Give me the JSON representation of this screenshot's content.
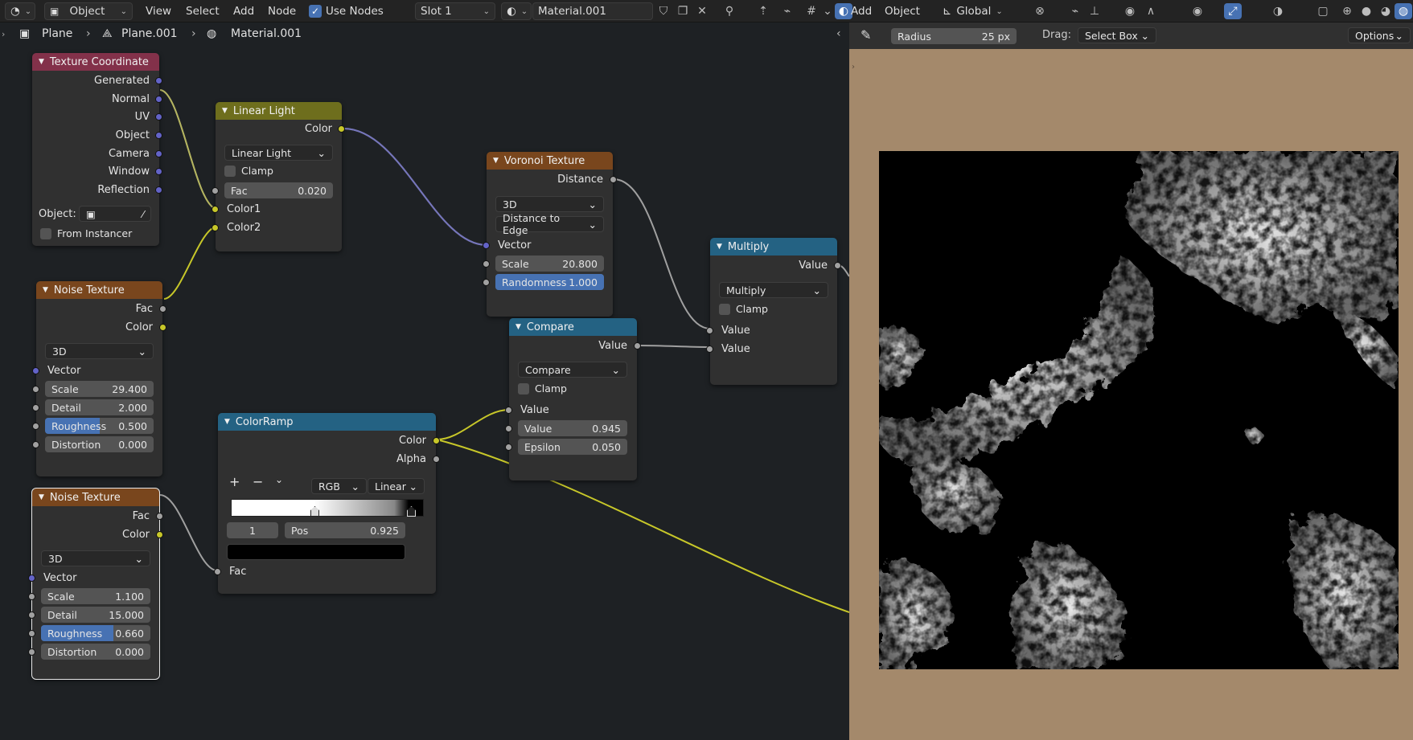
{
  "topbar": {
    "editor_type": "Object",
    "menus": [
      "View",
      "Select",
      "Add",
      "Node"
    ],
    "use_nodes_label": "Use Nodes",
    "slot": "Slot 1",
    "material": "Material.001",
    "right_menus": [
      "Add",
      "Object"
    ],
    "orientation": "Global"
  },
  "breadcrumb": {
    "object": "Plane",
    "mesh": "Plane.001",
    "material": "Material.001"
  },
  "nodes": {
    "texcoord": {
      "title": "Texture Coordinate",
      "outputs": [
        "Generated",
        "Normal",
        "UV",
        "Object",
        "Camera",
        "Window",
        "Reflection"
      ],
      "object_label": "Object:",
      "from_instancer": "From Instancer"
    },
    "linear_light": {
      "title": "Linear Light",
      "output": "Color",
      "mode": "Linear Light",
      "clamp": "Clamp",
      "fac_label": "Fac",
      "fac_value": "0.020",
      "inputs": [
        "Color1",
        "Color2"
      ]
    },
    "noise1": {
      "title": "Noise Texture",
      "outputs": [
        "Fac",
        "Color"
      ],
      "dimension": "3D",
      "vector": "Vector",
      "fields": [
        {
          "label": "Scale",
          "value": "29.400",
          "fill": 0
        },
        {
          "label": "Detail",
          "value": "2.000",
          "fill": 0
        },
        {
          "label": "Roughness",
          "value": "0.500",
          "fill": 0.5
        },
        {
          "label": "Distortion",
          "value": "0.000",
          "fill": 0
        }
      ]
    },
    "voronoi": {
      "title": "Voronoi Texture",
      "output": "Distance",
      "dimension": "3D",
      "feature": "Distance to Edge",
      "vector": "Vector",
      "fields": [
        {
          "label": "Scale",
          "value": "20.800",
          "fill": 0
        },
        {
          "label": "Randomness",
          "value": "1.000",
          "fill": 1
        }
      ]
    },
    "multiply": {
      "title": "Multiply",
      "output": "Value",
      "mode": "Multiply",
      "clamp": "Clamp",
      "inputs": [
        "Value",
        "Value"
      ]
    },
    "compare": {
      "title": "Compare",
      "output": "Value",
      "mode": "Compare",
      "clamp": "Clamp",
      "input": "Value",
      "fields": [
        {
          "label": "Value",
          "value": "0.945",
          "fill": 0
        },
        {
          "label": "Epsilon",
          "value": "0.050",
          "fill": 0
        }
      ]
    },
    "colorramp": {
      "title": "ColorRamp",
      "outputs": [
        "Color",
        "Alpha"
      ],
      "color_mode": "RGB",
      "interpolation": "Linear",
      "stop_index": "1",
      "pos_label": "Pos",
      "pos_value": "0.925",
      "input": "Fac"
    },
    "noise2": {
      "title": "Noise Texture",
      "outputs": [
        "Fac",
        "Color"
      ],
      "dimension": "3D",
      "vector": "Vector",
      "fields": [
        {
          "label": "Scale",
          "value": "1.100",
          "fill": 0
        },
        {
          "label": "Detail",
          "value": "15.000",
          "fill": 0
        },
        {
          "label": "Roughness",
          "value": "0.660",
          "fill": 0.66
        },
        {
          "label": "Distortion",
          "value": "0.000",
          "fill": 0
        }
      ]
    }
  },
  "viewport": {
    "radius_label": "Radius",
    "radius_value": "25 px",
    "drag_label": "Drag:",
    "drag_mode": "Select Box",
    "options": "Options"
  },
  "colors": {
    "socket_vector": "#6363c7",
    "socket_color": "#c7c729",
    "socket_float": "#a1a1a1",
    "header_input": "#83314a",
    "header_texture": "#79461d",
    "header_converter": "#246283",
    "header_color": "#6e6e1d",
    "accent": "#4772b3",
    "paint_background": "#a4896b"
  }
}
